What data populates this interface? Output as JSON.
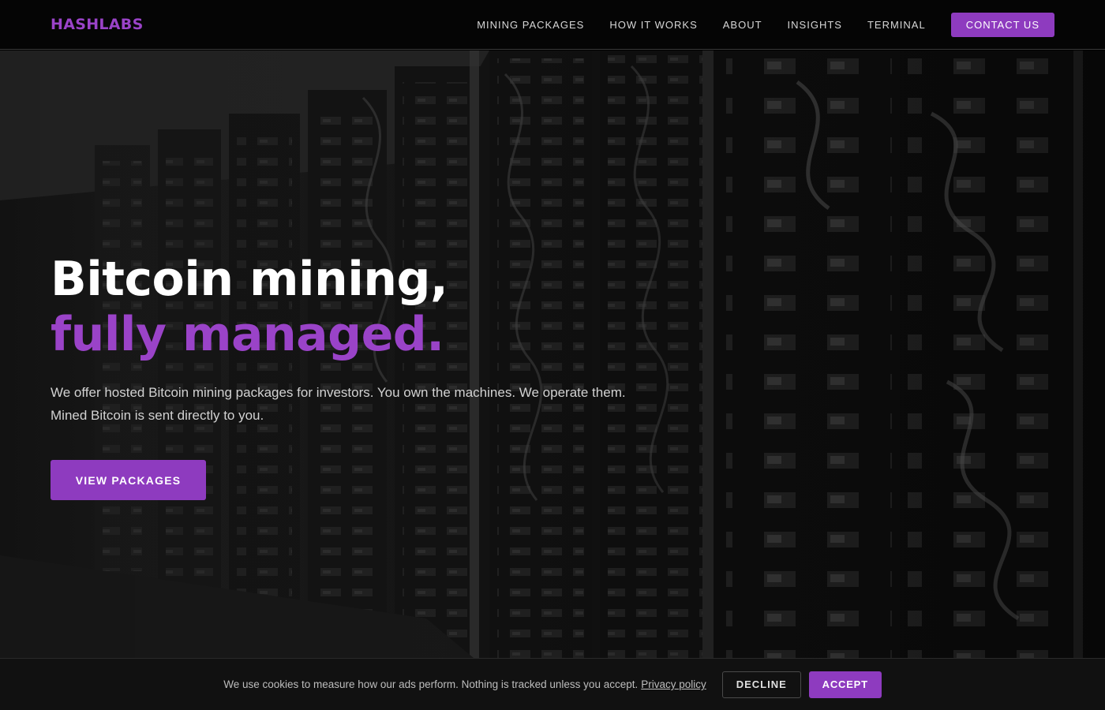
{
  "colors": {
    "accent": "#8e3bbf",
    "accent_text": "#9a43c8"
  },
  "header": {
    "logo": "HASHLABS",
    "nav": [
      {
        "label": "MINING PACKAGES"
      },
      {
        "label": "HOW IT WORKS"
      },
      {
        "label": "ABOUT"
      },
      {
        "label": "INSIGHTS"
      },
      {
        "label": "TERMINAL"
      }
    ],
    "contact_label": "CONTACT US"
  },
  "hero": {
    "title_line1": "Bitcoin mining,",
    "title_line2": "fully managed.",
    "subtitle": "We offer hosted Bitcoin mining packages for investors. You own the machines. We operate them. Mined Bitcoin is sent directly to you.",
    "cta_label": "VIEW PACKAGES",
    "background_image": "server-racks-photo"
  },
  "cookie_bar": {
    "text": "We use cookies to measure how our ads perform. Nothing is tracked unless you accept.",
    "link_label": "Privacy policy",
    "decline_label": "DECLINE",
    "accept_label": "ACCEPT"
  }
}
